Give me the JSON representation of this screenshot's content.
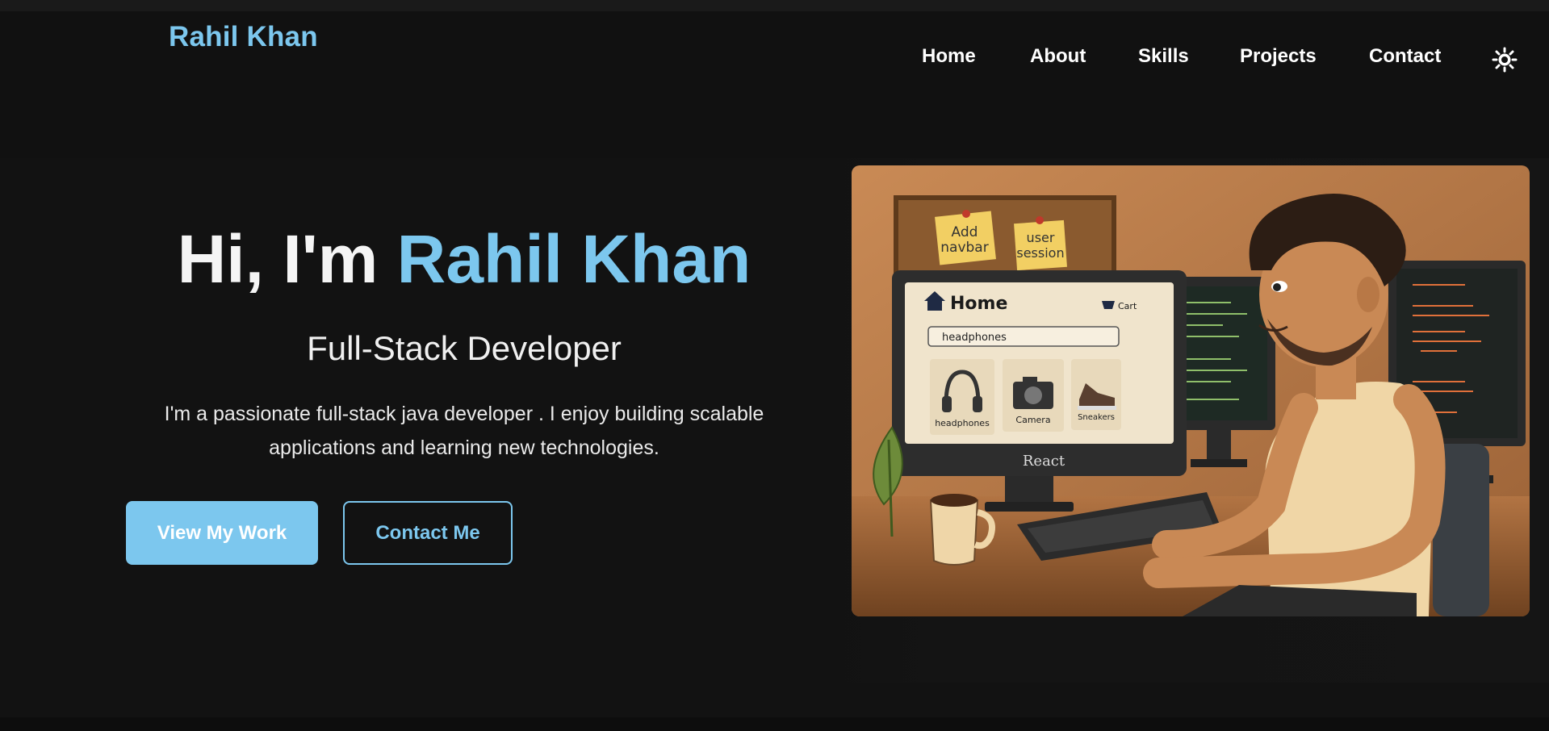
{
  "brand": {
    "name": "Rahil Khan"
  },
  "nav": {
    "items": [
      {
        "label": "Home"
      },
      {
        "label": "About"
      },
      {
        "label": "Skills"
      },
      {
        "label": "Projects"
      },
      {
        "label": "Contact"
      }
    ],
    "theme_toggle_icon": "sun-icon"
  },
  "hero": {
    "greeting": "Hi, I'm ",
    "name": "Rahil Khan",
    "subtitle": "Full-Stack Developer",
    "description": "I'm a passionate full-stack java developer . I enjoy building scalable applications and learning new technologies.",
    "primary_button": "View My Work",
    "secondary_button": "Contact Me"
  },
  "illustration": {
    "note_1": [
      "Add",
      "navbar"
    ],
    "note_2": [
      "user",
      "session"
    ],
    "screen_title": "Home",
    "cart_label": "Cart",
    "search_value": "headphones",
    "products": [
      "headphones",
      "Camera",
      "Sneakers"
    ],
    "monitor_label": "React"
  },
  "colors": {
    "accent": "#7cc7ee",
    "background": "#121212",
    "navbar": "#111111"
  }
}
